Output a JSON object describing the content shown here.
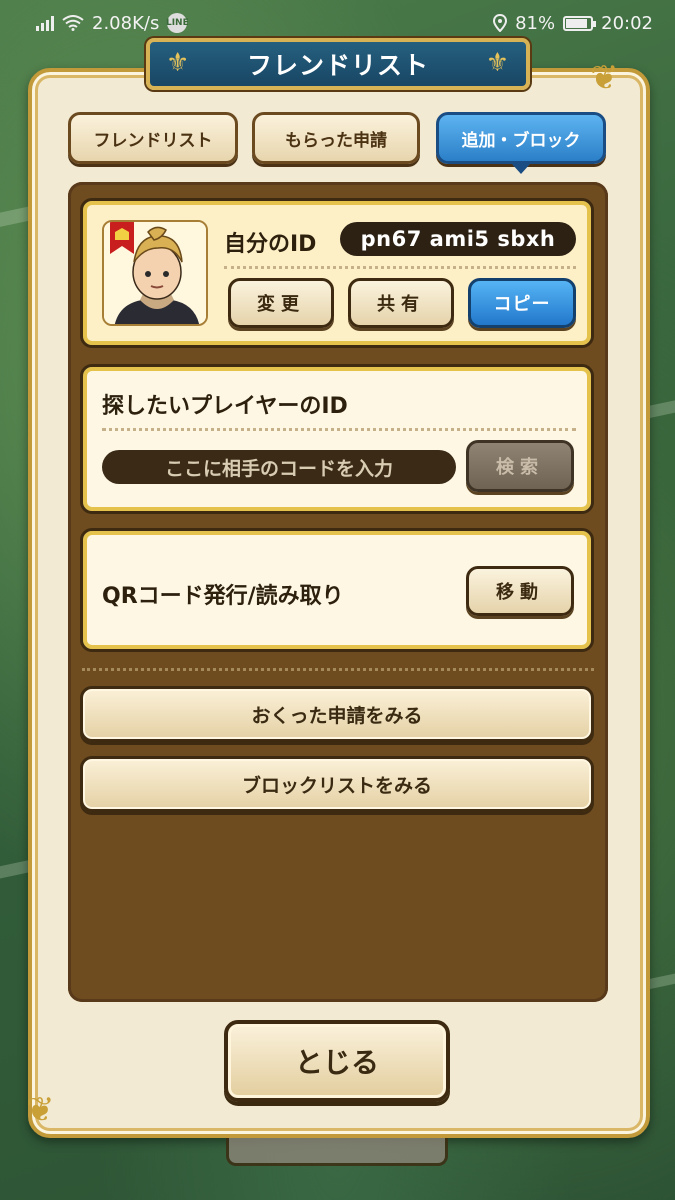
{
  "status_bar": {
    "speed": "2.08K/s",
    "line_badge": "LINE",
    "battery": "81%",
    "time": "20:02",
    "icons": [
      "signal-icon",
      "wifi-icon",
      "line-app-icon",
      "location-icon",
      "battery-icon"
    ]
  },
  "title": "フレンドリスト",
  "tabs": [
    {
      "label": "フレンドリスト",
      "active": false
    },
    {
      "label": "もらった申請",
      "active": false
    },
    {
      "label": "追加・ブロック",
      "active": true
    }
  ],
  "my_id": {
    "label": "自分のID",
    "value": "pn67 ami5 sbxh",
    "buttons": {
      "change": "変更",
      "share": "共有",
      "copy": "コピー"
    }
  },
  "search": {
    "label": "探したいプレイヤーのID",
    "placeholder": "ここに相手のコードを入力",
    "button": "検索"
  },
  "qr": {
    "label": "QRコード発行/読み取り",
    "button": "移動"
  },
  "links": {
    "sent_requests": "おくった申請をみる",
    "block_list": "ブロックリストをみる"
  },
  "close": "とじる",
  "colors": {
    "accent_blue": "#2b7fc8",
    "frame_gold": "#c29a3a",
    "panel_cream": "#f3ead3",
    "content_brown": "#6f4c1f"
  }
}
